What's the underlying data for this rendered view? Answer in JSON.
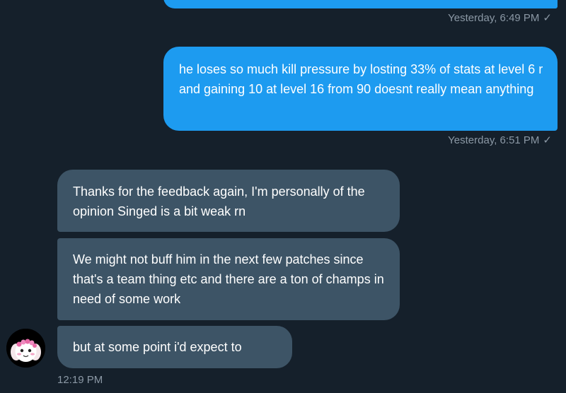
{
  "conversation": {
    "messages": [
      {
        "direction": "sent",
        "text": "",
        "timestamp": "Yesterday, 6:49 PM",
        "status_icon": "check-icon"
      },
      {
        "direction": "sent",
        "text": "he loses so much kill pressure by losting 33% of stats at level 6 r and gaining 10 at level 16 from 90 doesnt really mean anything",
        "timestamp": "Yesterday, 6:51 PM",
        "status_icon": "check-icon"
      },
      {
        "direction": "received",
        "text": "Thanks for the feedback again, I'm personally of the opinion Singed is a bit weak rn"
      },
      {
        "direction": "received",
        "text": "We might not buff him in the next few patches since that's a team thing etc and there are a ton of champs in need of some work"
      },
      {
        "direction": "received",
        "text": "but at some point i'd expect to",
        "timestamp": "12:19 PM"
      }
    ]
  },
  "contact": {
    "avatar_icon": "avatar-icon"
  },
  "colors": {
    "background": "#15202b",
    "sent_bubble": "#1d9bf0",
    "received_bubble": "#3d5466",
    "meta_text": "#8b98a5"
  }
}
